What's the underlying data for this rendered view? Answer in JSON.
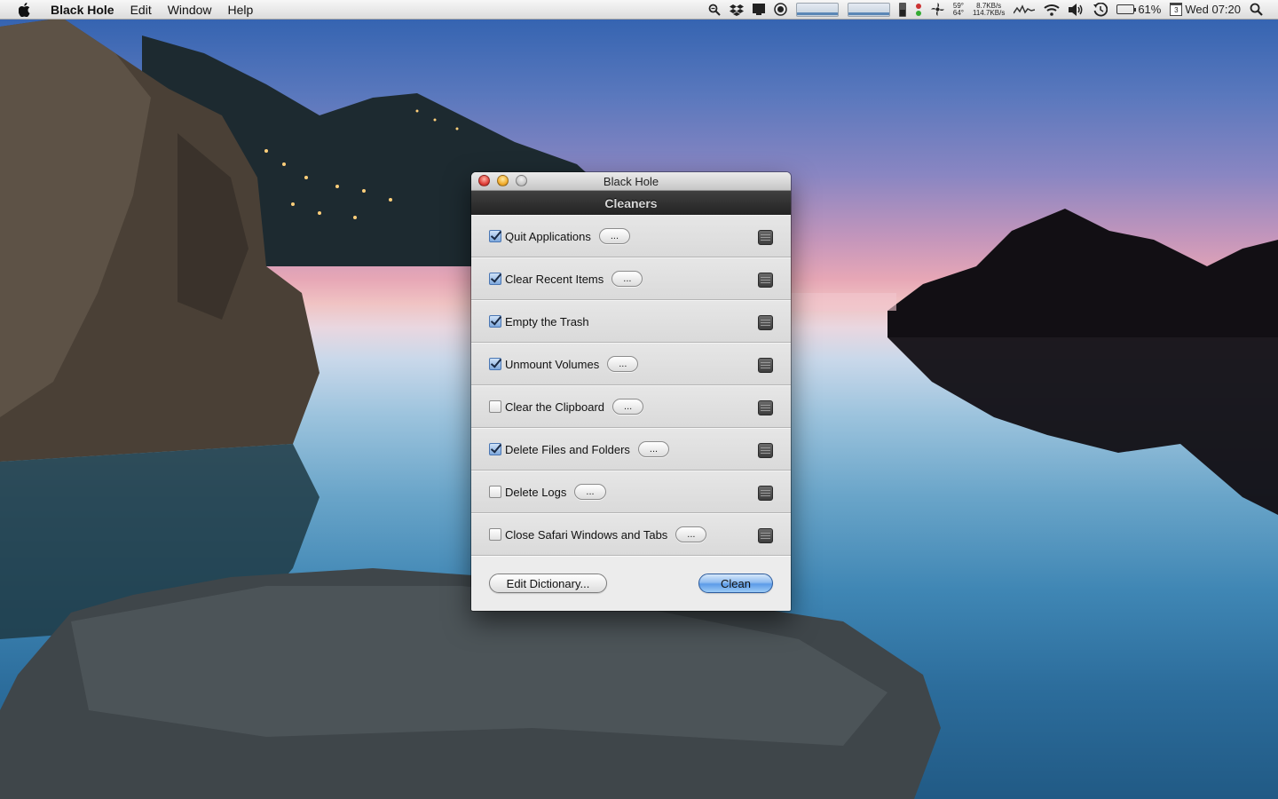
{
  "menubar": {
    "app_name": "Black Hole",
    "items": [
      "Edit",
      "Window",
      "Help"
    ],
    "status": {
      "temp_top": "59°",
      "temp_bottom": "64°",
      "net_up": "8.7KB/s",
      "net_down": "114.7KB/s",
      "battery": "61%",
      "calendar_day": "3",
      "clock": "Wed 07:20"
    }
  },
  "window": {
    "title": "Black Hole",
    "section_title": "Cleaners",
    "cleaners": [
      {
        "label": "Quit Applications",
        "checked": true,
        "options": "..."
      },
      {
        "label": "Clear Recent Items",
        "checked": true,
        "options": "..."
      },
      {
        "label": "Empty the Trash",
        "checked": true,
        "options": null
      },
      {
        "label": "Unmount Volumes",
        "checked": true,
        "options": "..."
      },
      {
        "label": "Clear the Clipboard",
        "checked": false,
        "options": "..."
      },
      {
        "label": "Delete Files and Folders",
        "checked": true,
        "options": "..."
      },
      {
        "label": "Delete Logs",
        "checked": false,
        "options": "..."
      },
      {
        "label": "Close Safari Windows and Tabs",
        "checked": false,
        "options": "..."
      }
    ],
    "edit_dictionary_label": "Edit Dictionary...",
    "clean_label": "Clean"
  },
  "colors": {
    "accent": "#5d9be8",
    "window_header": "#2e2e2e"
  }
}
